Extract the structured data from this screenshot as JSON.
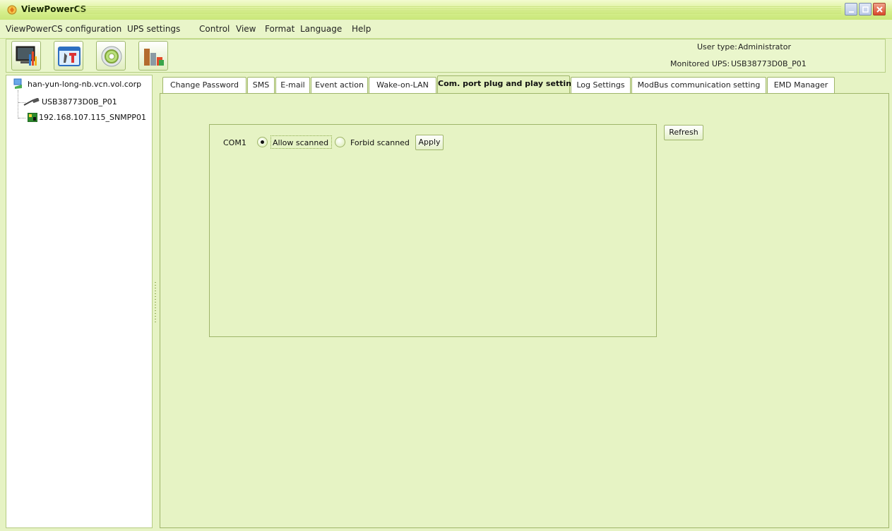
{
  "window": {
    "title": "ViewPowerCS"
  },
  "menu": [
    "ViewPowerCS  configuration",
    "UPS settings",
    "Control",
    "View",
    "Format",
    "Language",
    "Help"
  ],
  "toolbar": {
    "user_type_label": "User type:",
    "user_type_value": "Administrator",
    "monitored_ups_label": "Monitored UPS:",
    "monitored_ups_value": "USB38773D0B_P01"
  },
  "tree": {
    "root": "han-yun-long-nb.vcn.vol.corp",
    "children": [
      "USB38773D0B_P01",
      "192.168.107.115_SNMPP01"
    ]
  },
  "tabs": [
    "Change Password",
    "SMS",
    "E-mail",
    "Event action",
    "Wake-on-LAN",
    "Com. port plug and play setting",
    "Log Settings",
    "ModBus communication setting",
    "EMD Manager"
  ],
  "active_tab": "Com. port plug and play setting",
  "com_panel": {
    "port_label": "COM1",
    "allow_label": "Allow scanned",
    "forbid_label": "Forbid scanned",
    "selected": "Allow scanned",
    "apply_label": "Apply",
    "refresh_label": "Refresh"
  }
}
